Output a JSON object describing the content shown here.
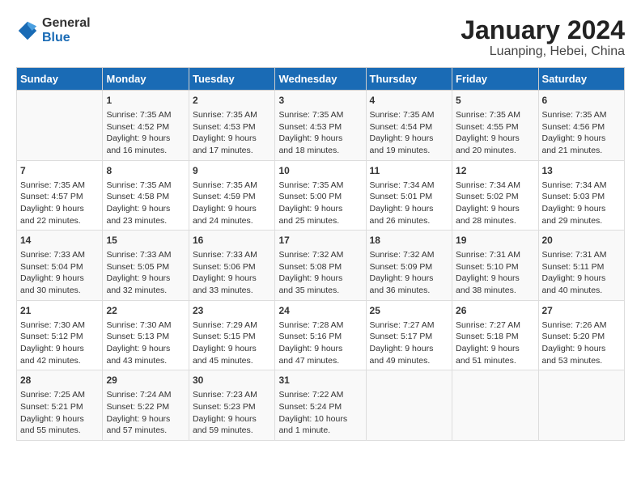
{
  "header": {
    "logo_line1": "General",
    "logo_line2": "Blue",
    "month_year": "January 2024",
    "location": "Luanping, Hebei, China"
  },
  "days_of_week": [
    "Sunday",
    "Monday",
    "Tuesday",
    "Wednesday",
    "Thursday",
    "Friday",
    "Saturday"
  ],
  "weeks": [
    [
      {
        "day": "",
        "content": ""
      },
      {
        "day": "1",
        "content": "Sunrise: 7:35 AM\nSunset: 4:52 PM\nDaylight: 9 hours\nand 16 minutes."
      },
      {
        "day": "2",
        "content": "Sunrise: 7:35 AM\nSunset: 4:53 PM\nDaylight: 9 hours\nand 17 minutes."
      },
      {
        "day": "3",
        "content": "Sunrise: 7:35 AM\nSunset: 4:53 PM\nDaylight: 9 hours\nand 18 minutes."
      },
      {
        "day": "4",
        "content": "Sunrise: 7:35 AM\nSunset: 4:54 PM\nDaylight: 9 hours\nand 19 minutes."
      },
      {
        "day": "5",
        "content": "Sunrise: 7:35 AM\nSunset: 4:55 PM\nDaylight: 9 hours\nand 20 minutes."
      },
      {
        "day": "6",
        "content": "Sunrise: 7:35 AM\nSunset: 4:56 PM\nDaylight: 9 hours\nand 21 minutes."
      }
    ],
    [
      {
        "day": "7",
        "content": "Sunrise: 7:35 AM\nSunset: 4:57 PM\nDaylight: 9 hours\nand 22 minutes."
      },
      {
        "day": "8",
        "content": "Sunrise: 7:35 AM\nSunset: 4:58 PM\nDaylight: 9 hours\nand 23 minutes."
      },
      {
        "day": "9",
        "content": "Sunrise: 7:35 AM\nSunset: 4:59 PM\nDaylight: 9 hours\nand 24 minutes."
      },
      {
        "day": "10",
        "content": "Sunrise: 7:35 AM\nSunset: 5:00 PM\nDaylight: 9 hours\nand 25 minutes."
      },
      {
        "day": "11",
        "content": "Sunrise: 7:34 AM\nSunset: 5:01 PM\nDaylight: 9 hours\nand 26 minutes."
      },
      {
        "day": "12",
        "content": "Sunrise: 7:34 AM\nSunset: 5:02 PM\nDaylight: 9 hours\nand 28 minutes."
      },
      {
        "day": "13",
        "content": "Sunrise: 7:34 AM\nSunset: 5:03 PM\nDaylight: 9 hours\nand 29 minutes."
      }
    ],
    [
      {
        "day": "14",
        "content": "Sunrise: 7:33 AM\nSunset: 5:04 PM\nDaylight: 9 hours\nand 30 minutes."
      },
      {
        "day": "15",
        "content": "Sunrise: 7:33 AM\nSunset: 5:05 PM\nDaylight: 9 hours\nand 32 minutes."
      },
      {
        "day": "16",
        "content": "Sunrise: 7:33 AM\nSunset: 5:06 PM\nDaylight: 9 hours\nand 33 minutes."
      },
      {
        "day": "17",
        "content": "Sunrise: 7:32 AM\nSunset: 5:08 PM\nDaylight: 9 hours\nand 35 minutes."
      },
      {
        "day": "18",
        "content": "Sunrise: 7:32 AM\nSunset: 5:09 PM\nDaylight: 9 hours\nand 36 minutes."
      },
      {
        "day": "19",
        "content": "Sunrise: 7:31 AM\nSunset: 5:10 PM\nDaylight: 9 hours\nand 38 minutes."
      },
      {
        "day": "20",
        "content": "Sunrise: 7:31 AM\nSunset: 5:11 PM\nDaylight: 9 hours\nand 40 minutes."
      }
    ],
    [
      {
        "day": "21",
        "content": "Sunrise: 7:30 AM\nSunset: 5:12 PM\nDaylight: 9 hours\nand 42 minutes."
      },
      {
        "day": "22",
        "content": "Sunrise: 7:30 AM\nSunset: 5:13 PM\nDaylight: 9 hours\nand 43 minutes."
      },
      {
        "day": "23",
        "content": "Sunrise: 7:29 AM\nSunset: 5:15 PM\nDaylight: 9 hours\nand 45 minutes."
      },
      {
        "day": "24",
        "content": "Sunrise: 7:28 AM\nSunset: 5:16 PM\nDaylight: 9 hours\nand 47 minutes."
      },
      {
        "day": "25",
        "content": "Sunrise: 7:27 AM\nSunset: 5:17 PM\nDaylight: 9 hours\nand 49 minutes."
      },
      {
        "day": "26",
        "content": "Sunrise: 7:27 AM\nSunset: 5:18 PM\nDaylight: 9 hours\nand 51 minutes."
      },
      {
        "day": "27",
        "content": "Sunrise: 7:26 AM\nSunset: 5:20 PM\nDaylight: 9 hours\nand 53 minutes."
      }
    ],
    [
      {
        "day": "28",
        "content": "Sunrise: 7:25 AM\nSunset: 5:21 PM\nDaylight: 9 hours\nand 55 minutes."
      },
      {
        "day": "29",
        "content": "Sunrise: 7:24 AM\nSunset: 5:22 PM\nDaylight: 9 hours\nand 57 minutes."
      },
      {
        "day": "30",
        "content": "Sunrise: 7:23 AM\nSunset: 5:23 PM\nDaylight: 9 hours\nand 59 minutes."
      },
      {
        "day": "31",
        "content": "Sunrise: 7:22 AM\nSunset: 5:24 PM\nDaylight: 10 hours\nand 1 minute."
      },
      {
        "day": "",
        "content": ""
      },
      {
        "day": "",
        "content": ""
      },
      {
        "day": "",
        "content": ""
      }
    ]
  ]
}
